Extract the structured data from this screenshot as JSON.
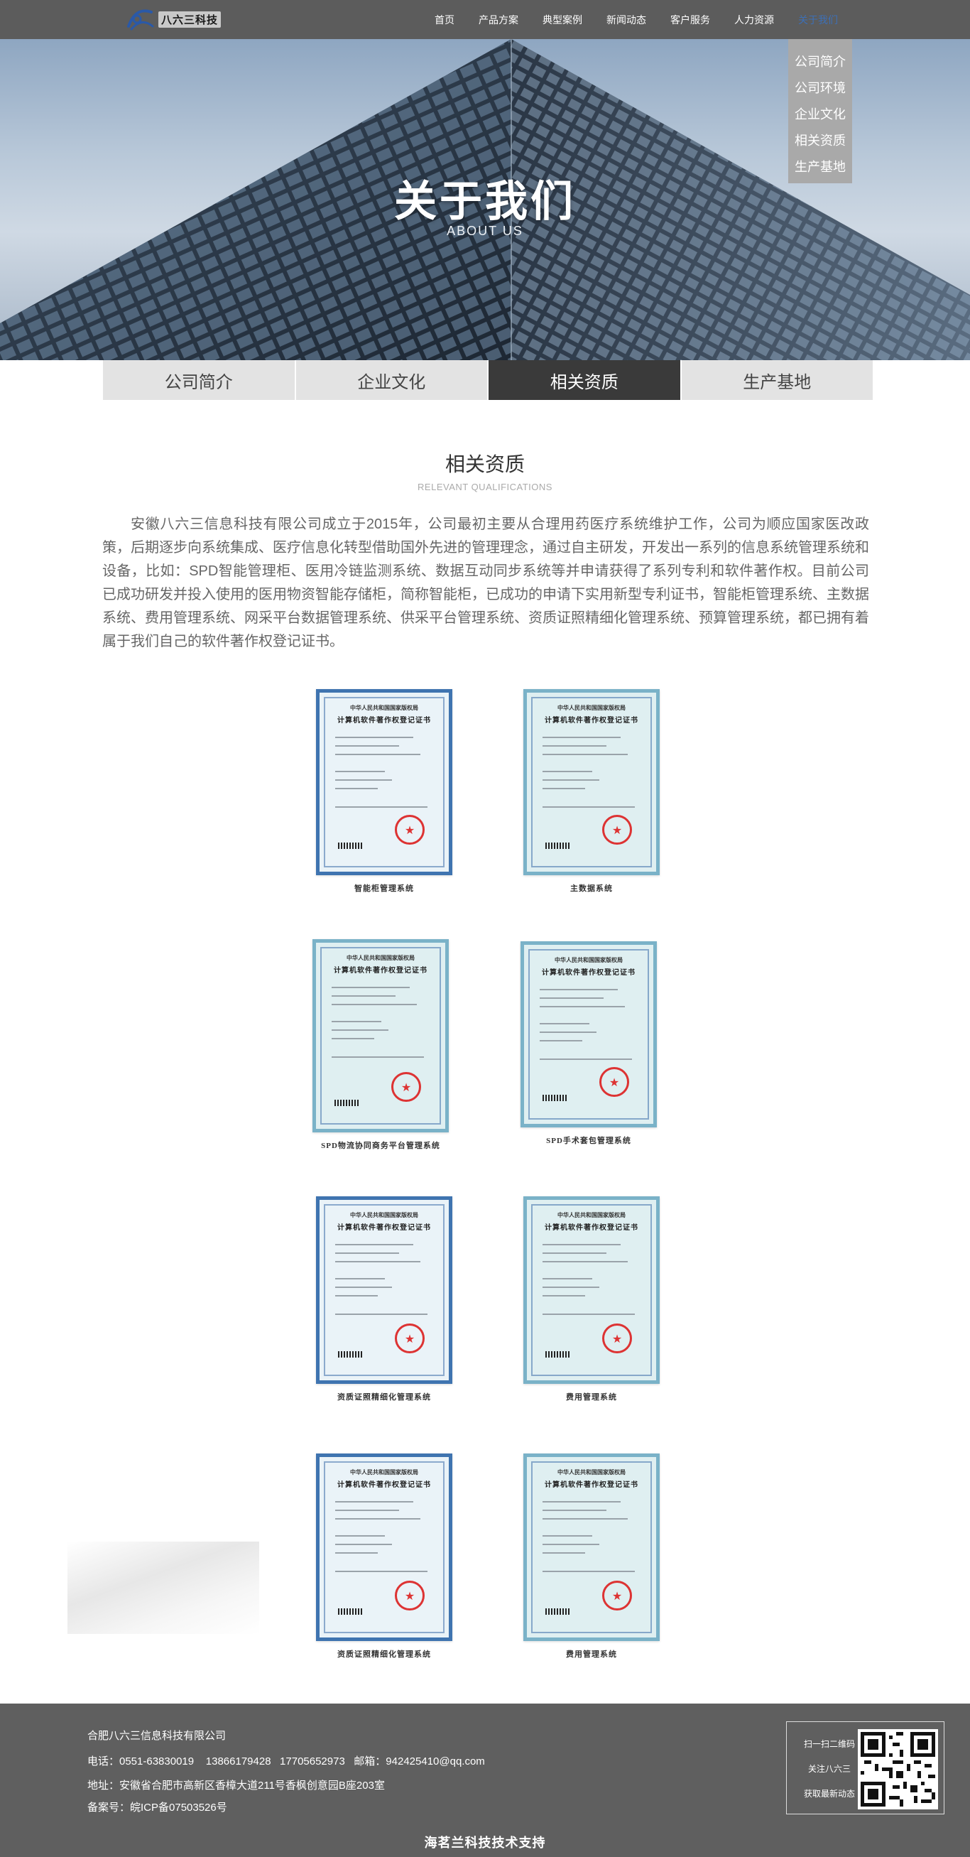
{
  "header": {
    "logo_text": "八六三科技",
    "nav": [
      {
        "label": "首页"
      },
      {
        "label": "产品方案"
      },
      {
        "label": "典型案例"
      },
      {
        "label": "新闻动态"
      },
      {
        "label": "客户服务"
      },
      {
        "label": "人力资源"
      },
      {
        "label": "关于我们"
      }
    ],
    "dropdown": [
      "公司简介",
      "公司环境",
      "企业文化",
      "相关资质",
      "生产基地"
    ]
  },
  "hero": {
    "title": "关于我们",
    "subtitle": "ABOUT US"
  },
  "tabs": [
    {
      "label": "公司简介",
      "active": false
    },
    {
      "label": "企业文化",
      "active": false
    },
    {
      "label": "相关资质",
      "active": true
    },
    {
      "label": "生产基地",
      "active": false
    }
  ],
  "section": {
    "title": "相关资质",
    "subtitle": "RELEVANT QUALIFICATIONS",
    "intro": "安徽八六三信息科技有限公司成立于2015年，公司最初主要从合理用药医疗系统维护工作，公司为顺应国家医改政策，后期逐步向系统集成、医疗信息化转型借助国外先进的管理理念，通过自主研发，开发出一系列的信息系统管理系统和设备，比如：SPD智能管理柜、医用冷链监测系统、数据互动同步系统等并申请获得了系列专利和软件著作权。目前公司已成功研发并投入使用的医用物资智能存储柜，简称智能柜，已成功的申请下实用新型专利证书，智能柜管理系统、主数据系统、费用管理系统、网采平台数据管理系统、供采平台管理系统、资质证照精细化管理系统、预算管理系统，都已拥有着属于我们自己的软件著作权登记证书。"
  },
  "certificates": {
    "header_line1": "中华人民共和国国家版权局",
    "header_line2": "计算机软件著作权登记证书",
    "items": [
      {
        "caption": "智能柜管理系统"
      },
      {
        "caption": "主数据系统"
      },
      {
        "caption": "SPD物流协同商务平台管理系统"
      },
      {
        "caption": "SPD手术套包管理系统"
      },
      {
        "caption": "资质证照精细化管理系统"
      },
      {
        "caption": "费用管理系统"
      },
      {
        "caption": "资质证照精细化管理系统"
      },
      {
        "caption": "费用管理系统"
      }
    ]
  },
  "footer": {
    "company": "合肥八六三信息科技有限公司",
    "contact": "电话：0551-63830019    13866179428   17705652973   邮箱：942425410@qq.com",
    "address": "地址：安徽省合肥市高新区香樟大道211号香枫创意园B座203室",
    "icp": "备案号：皖ICP备07503526号",
    "qr_lines": [
      "扫一扫二维码",
      "关注八六三",
      "获取最新动态"
    ],
    "support": "海茗兰科技技术支持"
  },
  "colors": {
    "header_bg": "#5c5c5c",
    "nav_active": "#3d6fb5",
    "tab_active_bg": "#3a3a3a",
    "tab_bg": "#e3e3e3",
    "footer_bg": "#5f5f5f",
    "dropdown_bg": "#a9a9a9"
  }
}
